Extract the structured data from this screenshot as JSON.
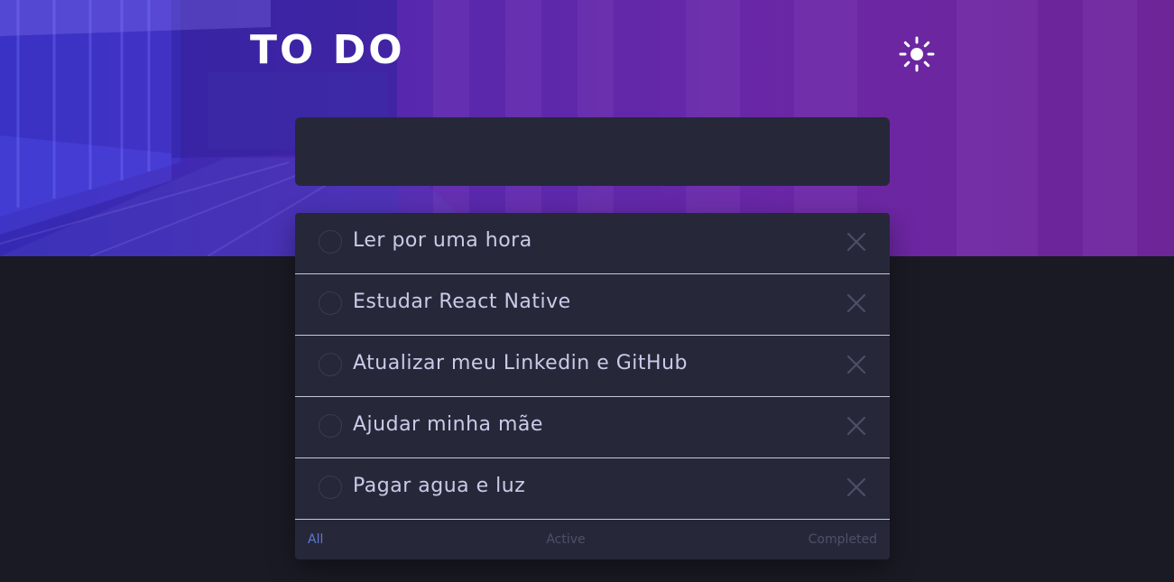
{
  "app": {
    "title": "TO DO",
    "theme_icon": "sun-icon"
  },
  "new_todo": {
    "value": "",
    "placeholder": ""
  },
  "todos": [
    {
      "text": "Ler por uma hora"
    },
    {
      "text": "Estudar React Native"
    },
    {
      "text": "Atualizar meu Linkedin e GitHub"
    },
    {
      "text": "Ajudar minha mãe"
    },
    {
      "text": "Pagar agua e luz"
    }
  ],
  "filters": {
    "all": "All",
    "active": "Active",
    "completed": "Completed",
    "selected": "all"
  },
  "colors": {
    "background": "#191a23",
    "card": "#262839",
    "text": "#c9cbe8",
    "accent": "#5c79d6",
    "gradient_start": "#3a2fc4",
    "gradient_end": "#7e2a9c"
  }
}
